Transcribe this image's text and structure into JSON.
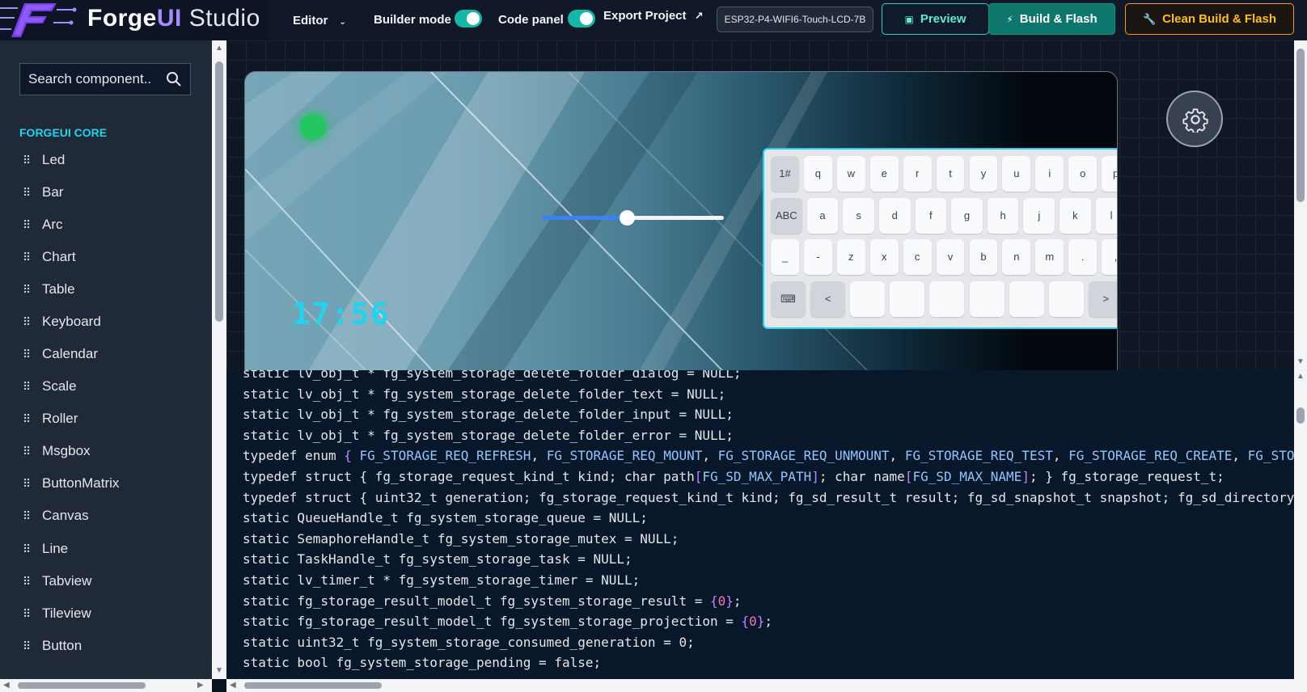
{
  "header": {
    "logo": {
      "brand": "Forge",
      "brand_ui": "UI",
      "brand_studio": "Studio"
    },
    "editor_menu": {
      "label": "Editor",
      "chevron": "chevron-down-icon"
    },
    "builder_mode": {
      "label": "Builder mode",
      "enabled": true
    },
    "code_panel": {
      "label": "Code panel",
      "enabled": true
    },
    "export": {
      "label": "Export Project",
      "icon": "external-link-icon"
    },
    "device": {
      "value": "ESP32-P4-WIFI6-Touch-LCD-7B"
    },
    "preview": {
      "label": "Preview",
      "icon": "preview-icon"
    },
    "build_flash": {
      "label": "Build & Flash",
      "icon": "bolt-icon"
    },
    "clean_build_flash": {
      "label": "Clean Build & Flash",
      "icon": "wrench-icon"
    }
  },
  "sidebar": {
    "search": {
      "placeholder": "Search component..",
      "icon": "search-icon"
    },
    "section_title": "FORGEUI CORE",
    "items": [
      "Led",
      "Bar",
      "Arc",
      "Chart",
      "Table",
      "Keyboard",
      "Calendar",
      "Scale",
      "Roller",
      "Msgbox",
      "ButtonMatrix",
      "Canvas",
      "Line",
      "Tabview",
      "Tileview",
      "Button"
    ]
  },
  "canvas": {
    "led": {
      "color": "#22c55e",
      "on": true
    },
    "slider": {
      "value": 0.47
    },
    "clock": "17:56",
    "settings_icon": "gear-icon",
    "keyboard": {
      "rows": [
        [
          "1#",
          "q",
          "w",
          "e",
          "r",
          "t",
          "y",
          "u",
          "i",
          "o",
          "p",
          "⌫"
        ],
        [
          "ABC",
          "a",
          "s",
          "d",
          "f",
          "g",
          "h",
          "j",
          "k",
          "l",
          "↵"
        ],
        [
          "_",
          "-",
          "z",
          "x",
          "c",
          "v",
          "b",
          "n",
          "m",
          ".",
          ",",
          ":"
        ],
        [
          "⌨",
          "<",
          "",
          "",
          "",
          "",
          "",
          "",
          ">",
          "✓"
        ]
      ]
    }
  },
  "code": {
    "lines": [
      "static lv_obj_t * fg_system_storage_delete_folder_dialog = NULL;",
      "static lv_obj_t * fg_system_storage_delete_folder_text = NULL;",
      "static lv_obj_t * fg_system_storage_delete_folder_input = NULL;",
      "static lv_obj_t * fg_system_storage_delete_folder_error = NULL;",
      "typedef enum { FG_STORAGE_REQ_REFRESH, FG_STORAGE_REQ_MOUNT, FG_STORAGE_REQ_UNMOUNT, FG_STORAGE_REQ_TEST, FG_STORAGE_REQ_CREATE, FG_STO",
      "typedef struct { fg_storage_request_kind_t kind; char path[FG_SD_MAX_PATH]; char name[FG_SD_MAX_NAME]; } fg_storage_request_t;",
      "typedef struct { uint32_t generation; fg_storage_request_kind_t kind; fg_sd_result_t result; fg_sd_snapshot_t snapshot; fg_sd_directory",
      "static QueueHandle_t fg_system_storage_queue = NULL;",
      "static SemaphoreHandle_t fg_system_storage_mutex = NULL;",
      "static TaskHandle_t fg_system_storage_task = NULL;",
      "static lv_timer_t * fg_system_storage_timer = NULL;",
      "static fg_storage_result_model_t fg_system_storage_result = {0};",
      "static fg_storage_result_model_t fg_system_storage_projection = {0};",
      "static uint32_t fg_system_storage_consumed_generation = 0;",
      "static bool fg_system_storage_pending = false;"
    ]
  }
}
